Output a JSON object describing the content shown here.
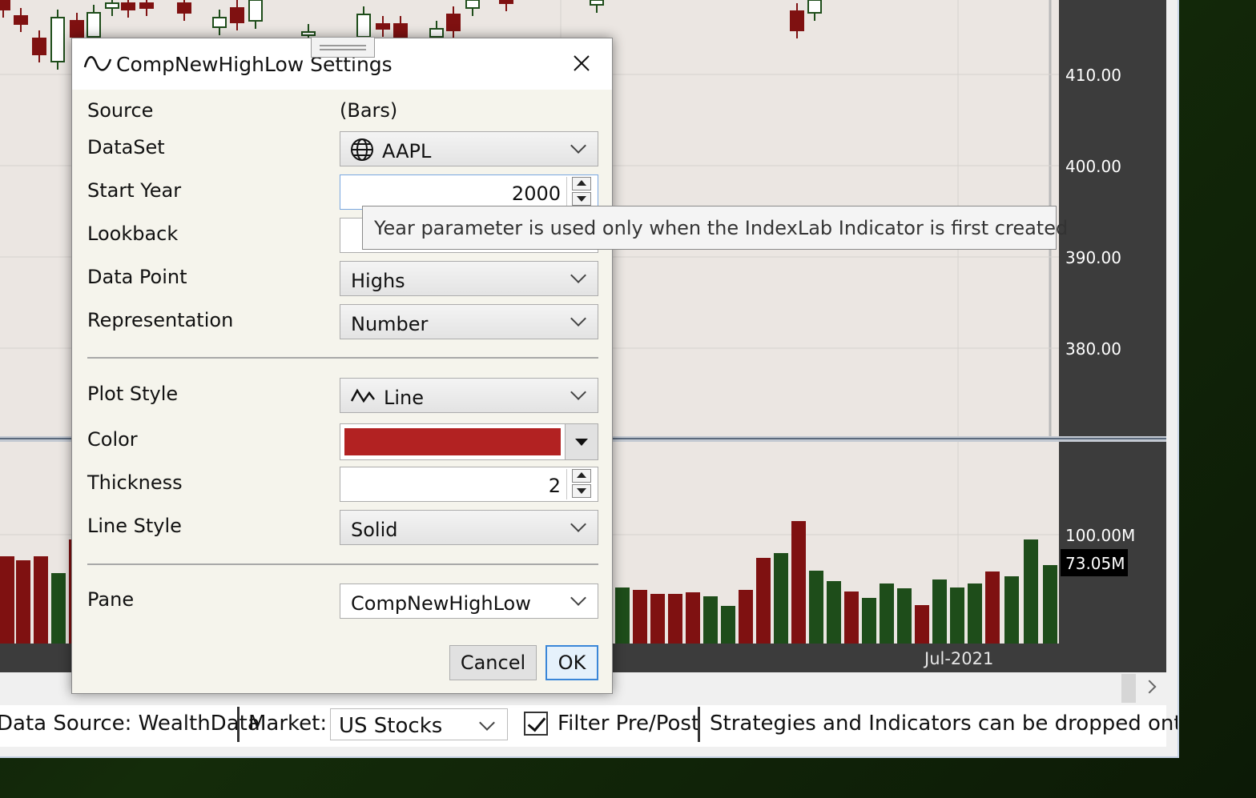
{
  "chart": {
    "price_axis": [
      "410.00",
      "400.00",
      "390.00",
      "380.00"
    ],
    "volume_axis": "100.00M",
    "volume_last": "73.05M",
    "date_label": "Jul-2021",
    "colors": {
      "up": "#1e4d1a",
      "down": "#7f1111",
      "pane_bg": "#ebe6e2",
      "axis_bg": "#3c3c3c"
    }
  },
  "statusbar": {
    "datasource": "Data Source: WealthData",
    "market_label": "Market:",
    "market_value": "US Stocks",
    "filter_label": "Filter Pre/Post",
    "filter_checked": true,
    "hint": "Strategies and Indicators can be dropped onto C"
  },
  "dialog": {
    "title": "CompNewHighLow Settings",
    "fields": {
      "source": {
        "label": "Source",
        "value": "(Bars)"
      },
      "dataset": {
        "label": "DataSet",
        "value": "AAPL",
        "icon": "globe-icon"
      },
      "start_year": {
        "label": "Start Year",
        "value": "2000"
      },
      "lookback": {
        "label": "Lookback"
      },
      "data_point": {
        "label": "Data Point",
        "value": "Highs"
      },
      "representation": {
        "label": "Representation",
        "value": "Number"
      },
      "plot_style": {
        "label": "Plot Style",
        "value": "Line",
        "icon": "line-plot-icon"
      },
      "color": {
        "label": "Color",
        "value": "#b22222"
      },
      "thickness": {
        "label": "Thickness",
        "value": "2"
      },
      "line_style": {
        "label": "Line Style",
        "value": "Solid"
      },
      "pane": {
        "label": "Pane",
        "value": "CompNewHighLow"
      }
    },
    "buttons": {
      "cancel": "Cancel",
      "ok": "OK"
    }
  },
  "tooltip": {
    "text": "Year parameter is used only when the IndexLab Indicator is first created"
  }
}
